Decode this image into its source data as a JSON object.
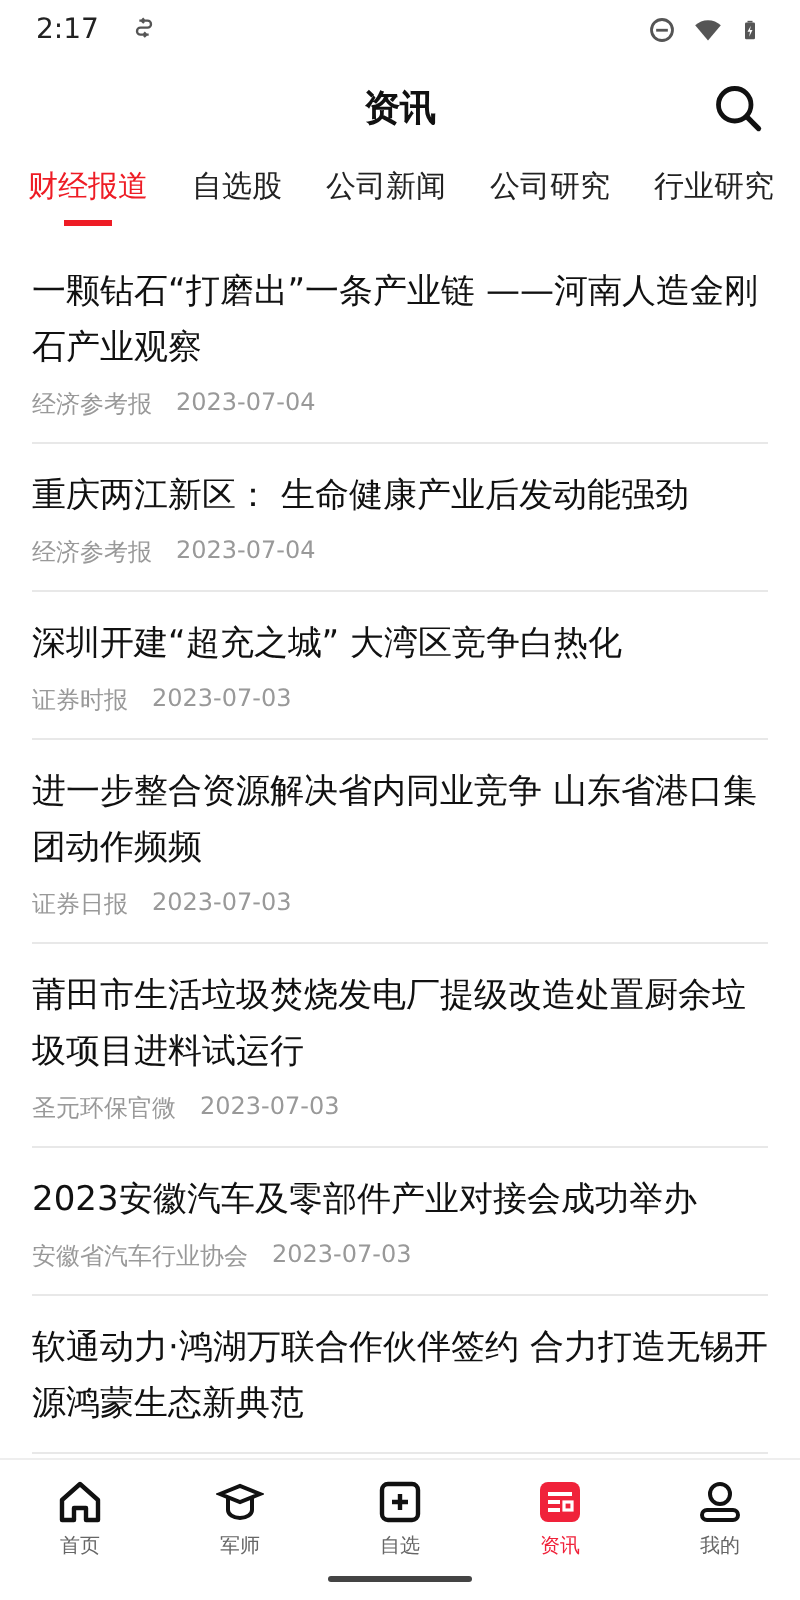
{
  "status_bar": {
    "time": "2:17"
  },
  "header": {
    "title": "资讯"
  },
  "tabs": [
    {
      "label": "财经报道",
      "selected": true
    },
    {
      "label": "自选股",
      "selected": false
    },
    {
      "label": "公司新闻",
      "selected": false
    },
    {
      "label": "公司研究",
      "selected": false
    },
    {
      "label": "行业研究",
      "selected": false
    }
  ],
  "articles": [
    {
      "title": "一颗钻石“打磨出”一条产业链 ——河南人造金刚石产业观察",
      "source": "经济参考报",
      "date": "2023-07-04"
    },
    {
      "title": "重庆两江新区： 生命健康产业后发动能强劲",
      "source": "经济参考报",
      "date": "2023-07-04"
    },
    {
      "title": "深圳开建“超充之城” 大湾区竞争白热化",
      "source": "证券时报",
      "date": "2023-07-03"
    },
    {
      "title": "进一步整合资源解决省内同业竞争 山东省港口集团动作频频",
      "source": "证券日报",
      "date": "2023-07-03"
    },
    {
      "title": "莆田市生活垃圾焚烧发电厂提级改造处置厨余垃圾项目进料试运行",
      "source": "圣元环保官微",
      "date": "2023-07-03"
    },
    {
      "title": "2023安徽汽车及零部件产业对接会成功举办",
      "source": "安徽省汽车行业协会",
      "date": "2023-07-03"
    },
    {
      "title": "软通动力·鸿湖万联合作伙伴签约 合力打造无锡开源鸿蒙生态新典范"
    }
  ],
  "bottom_nav": [
    {
      "label": "首页",
      "kind": "home",
      "selected": false
    },
    {
      "label": "军师",
      "kind": "cap",
      "selected": false
    },
    {
      "label": "自选",
      "kind": "plus",
      "selected": false
    },
    {
      "label": "资讯",
      "kind": "news",
      "selected": true
    },
    {
      "label": "我的",
      "kind": "user",
      "selected": false
    }
  ]
}
